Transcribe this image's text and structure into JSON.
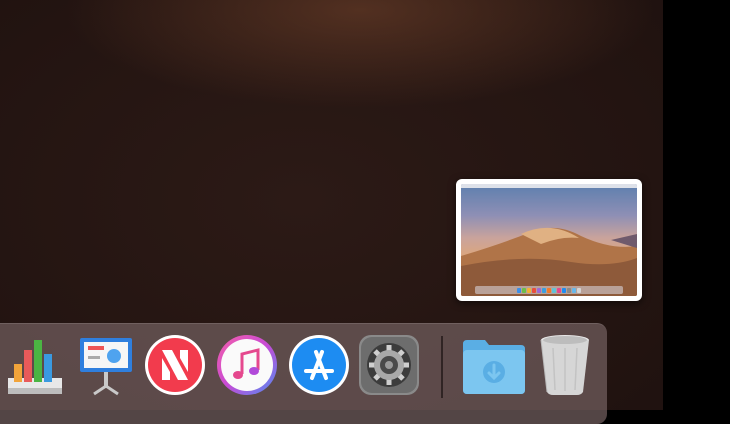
{
  "dock": {
    "apps": [
      {
        "id": "numbers",
        "icon": "numbers-icon"
      },
      {
        "id": "keynote",
        "icon": "keynote-icon"
      },
      {
        "id": "news",
        "icon": "news-icon"
      },
      {
        "id": "itunes",
        "icon": "itunes-icon"
      },
      {
        "id": "app-store",
        "icon": "app-store-icon"
      },
      {
        "id": "system-preferences",
        "icon": "system-preferences-icon"
      },
      {
        "id": "downloads",
        "icon": "downloads-folder-icon"
      },
      {
        "id": "trash",
        "icon": "trash-icon"
      }
    ]
  },
  "thumbnail": {
    "icon": "screenshot-thumbnail"
  },
  "colors": {
    "desktop": "#231411",
    "dock": "#735f5f",
    "news_red": "#f23b4d",
    "itunes_pink": "#e5488e",
    "appstore_blue": "#1d8cf2",
    "folder_blue": "#67b8ea"
  }
}
